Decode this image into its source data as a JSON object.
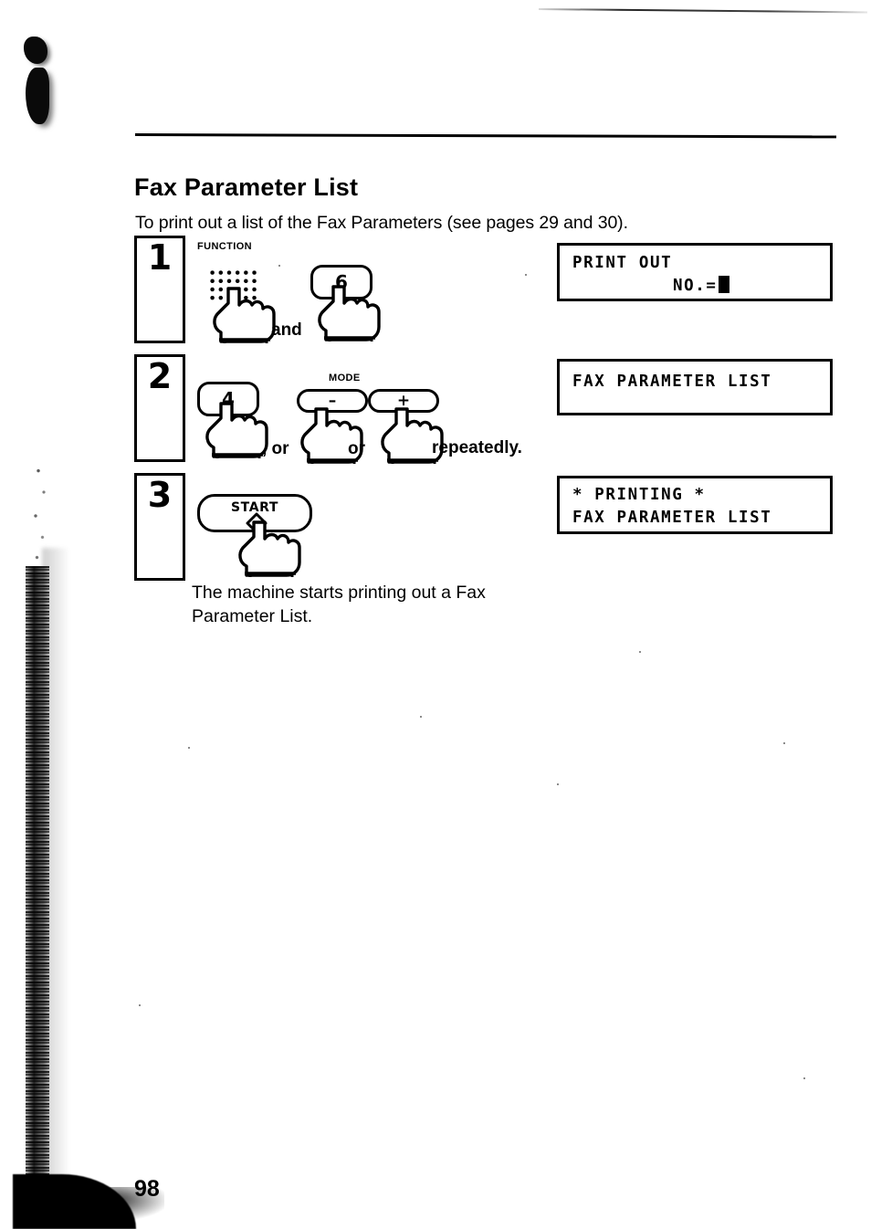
{
  "document": {
    "title": "Fax Parameter List",
    "subtitle": "To print out a list of the Fax Parameters (see pages 29 and 30).",
    "page_number": "98"
  },
  "steps": [
    {
      "number": "1",
      "keys": [
        {
          "label": "FUNCTION",
          "glyph": "",
          "type": "dot-matrix"
        },
        {
          "label": "",
          "glyph": "6",
          "type": "round"
        }
      ],
      "connector_text": "and",
      "trailing_text": ""
    },
    {
      "number": "2",
      "keys": [
        {
          "label": "",
          "glyph": "4",
          "type": "round"
        },
        {
          "label": "MODE",
          "glyph": "–",
          "type": "pill-left"
        },
        {
          "label": "",
          "glyph": "+",
          "type": "pill-right"
        }
      ],
      "connector_text": ", or",
      "connector_text_2": "or",
      "trailing_text": "repeatedly."
    },
    {
      "number": "3",
      "keys": [
        {
          "label": "START",
          "glyph": "",
          "type": "wide"
        }
      ],
      "note": "The machine starts printing out a Fax Parameter List.",
      "note_line_1": "The machine starts printing out a Fax",
      "note_line_2": "Parameter List."
    }
  ],
  "displays": [
    {
      "line1": "PRINT OUT",
      "line2": "NO.=",
      "cursor": true
    },
    {
      "line1": "FAX PARAMETER LIST",
      "line2": "",
      "cursor": false
    },
    {
      "line1": "* PRINTING *",
      "line2": "FAX PARAMETER LIST",
      "cursor": false
    }
  ],
  "colors": {
    "ink": "#000000",
    "paper": "#ffffff"
  }
}
